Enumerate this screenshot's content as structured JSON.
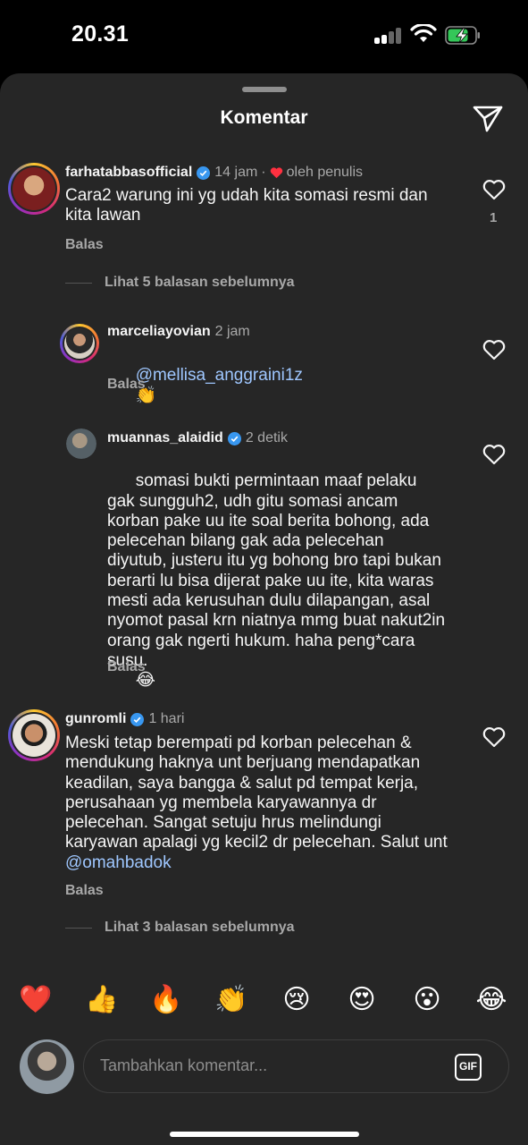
{
  "status_bar": {
    "time": "20.31"
  },
  "sheet": {
    "title": "Komentar"
  },
  "comments": [
    {
      "username": "farhatabbasofficial",
      "verified": true,
      "time": "14 jam",
      "liked_by_author": "oleh penulis",
      "text": "Cara2 warung ini yg udah kita somasi resmi dan kita lawan",
      "like_count": "1",
      "reply_label": "Balas"
    },
    {
      "username": "marceliayovian",
      "verified": false,
      "time": "2 jam",
      "text_mention": "@mellisa_anggraini1z",
      "text_emoji": "👏",
      "reply_label": "Balas"
    },
    {
      "username": "muannas_alaidid",
      "verified": true,
      "time": "2 detik",
      "text": "somasi bukti permintaan maaf pelaku gak sungguh2, udh gitu somasi ancam korban pake uu ite soal berita bohong, ada pelecehan bilang gak ada pelecehan diyutub, justeru itu yg bohong bro tapi bukan berarti lu bisa dijerat pake uu ite, kita waras mesti ada kerusuhan dulu dilapangan, asal nyomot pasal krn niatnya mmg buat nakut2in orang gak ngerti hukum. haha peng*cara susu.",
      "text_emoji": "😂",
      "reply_label": "Balas"
    },
    {
      "username": "gunromli",
      "verified": true,
      "time": "1 hari",
      "text": "Meski tetap berempati pd korban pelecehan & mendukung haknya unt berjuang mendapatkan keadilan, saya bangga & salut pd tempat kerja, perusahaan yg membela karyawannya dr pelecehan. Sangat setuju hrus melindungi karyawan apalagi yg kecil2 dr pelecehan. Salut unt ",
      "text_mention": "@omahbadok",
      "reply_label": "Balas"
    }
  ],
  "view_replies": [
    {
      "label": "Lihat 5 balasan sebelumnya"
    },
    {
      "label": "Lihat 3 balasan sebelumnya"
    }
  ],
  "emoji_bar": [
    "❤️",
    "👍",
    "🔥",
    "👏",
    "😢",
    "😍",
    "😮",
    "😂"
  ],
  "composer": {
    "placeholder": "Tambahkan komentar...",
    "gif_label": "GIF"
  },
  "colors": {
    "sheet_bg": "#262626",
    "mention": "#9fc7ff",
    "verified": "#3897f0",
    "heart": "#ff3040"
  }
}
